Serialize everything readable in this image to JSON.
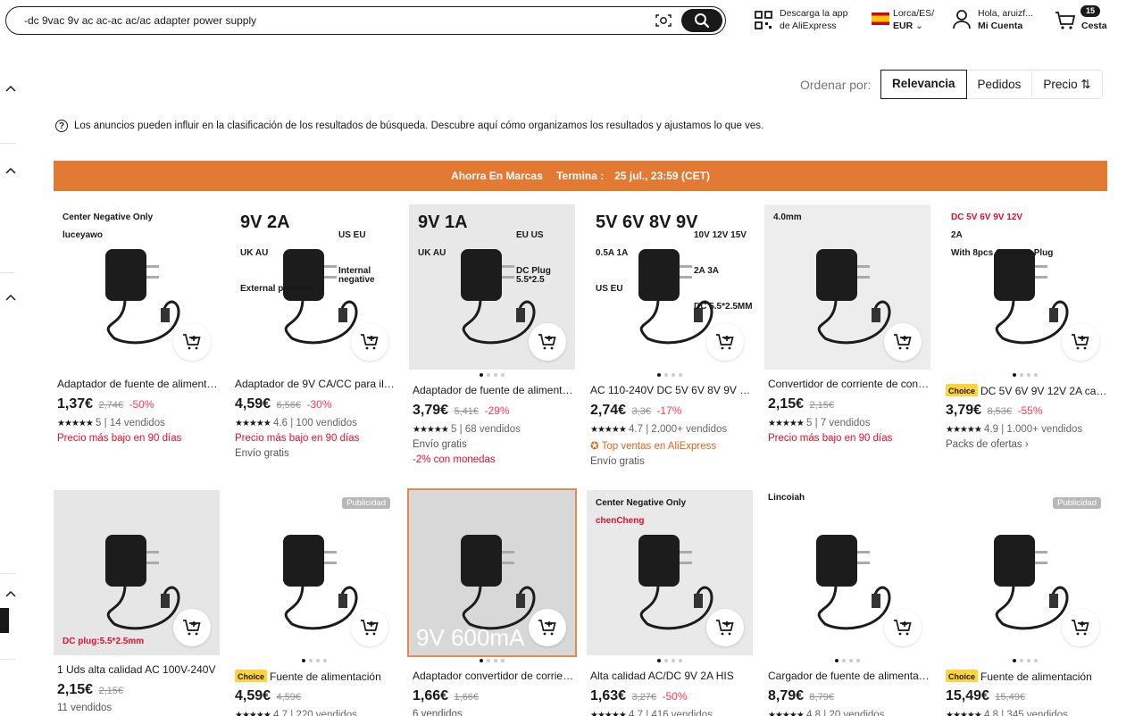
{
  "header": {
    "search_value": "-dc 9vac 9v ac ac-ac ac/ac adapter power supply",
    "app_line1": "Descarga la app",
    "app_line2": "de AliExpress",
    "region_line1": "Lorca/ES/",
    "region_line2": "EUR",
    "user_line1": "Hola, aruizf...",
    "user_line2": "Mi Cuenta",
    "cart_count": "15",
    "cart_label": "Cesta"
  },
  "sort": {
    "label": "Ordenar por:",
    "options": [
      "Relevancia",
      "Pedidos",
      "Precio"
    ],
    "active": "Relevancia"
  },
  "ads_notice": "Los anuncios pueden influir en la clasificación de los resultados de búsqueda. Descubre aquí cómo organizamos los resultados y ajustamos lo que ves.",
  "banner": {
    "title": "Ahorra En Marcas",
    "ends_label": "Termina :",
    "ends_value": "25 jul., 23:59 (CET)"
  },
  "products": [
    {
      "img_text": [
        "Center Negative Only",
        "luceyawo"
      ],
      "title": "Adaptador de fuente de alimentación",
      "choice": false,
      "price": "1,37€",
      "old": "2,74€",
      "disc": "-50%",
      "rating": "5",
      "sold": "14 vendidos",
      "lines": [
        {
          "t": "Precio más bajo en 90 días",
          "c": "red"
        }
      ]
    },
    {
      "img_text": [
        "9V 2A",
        "US EU",
        "UK AU",
        "Internal negative",
        "External positive"
      ],
      "title": "Adaptador de 9V CA/CC para iluminación",
      "choice": false,
      "price": "4,59€",
      "old": "6,56€",
      "disc": "-30%",
      "rating": "4.6",
      "sold": "100 vendidos",
      "lines": [
        {
          "t": "Precio más bajo en 90 días",
          "c": "red"
        },
        {
          "t": "Envío gratis",
          "c": "gray"
        }
      ]
    },
    {
      "img_text": [
        "9V 1A",
        "EU US",
        "UK AU",
        "DC Plug 5.5*2.5"
      ],
      "title": "Adaptador de fuente de alimentación",
      "choice": false,
      "price": "3,79€",
      "old": "5,41€",
      "disc": "-29%",
      "rating": "5",
      "sold": "68 vendidos",
      "lines": [
        {
          "t": "Envío gratis",
          "c": "gray"
        },
        {
          "t": "-2% con monedas",
          "c": "red"
        }
      ]
    },
    {
      "img_text": [
        "5V 6V 8V 9V",
        "10V 12V 15V",
        "0.5A 1A",
        "2A 3A",
        "US EU",
        "DC  5.5*2.5MM"
      ],
      "title": "AC 110-240V DC 5V 6V 8V 9V 10V",
      "choice": false,
      "price": "2,74€",
      "old": "3,3€",
      "disc": "-17%",
      "rating": "4.7",
      "sold": "2.000+ vendidos",
      "lines": [
        {
          "t": "Top ventas en AliExpress",
          "c": "orange"
        },
        {
          "t": "Envío gratis",
          "c": "gray"
        }
      ]
    },
    {
      "img_text": [
        "4.0mm"
      ],
      "title": "Convertidor de corriente de conmutación",
      "choice": false,
      "price": "2,15€",
      "old": "2,15€",
      "disc": "",
      "rating": "5",
      "sold": "7 vendidos",
      "lines": [
        {
          "t": "Precio más bajo en 90 días",
          "c": "red"
        }
      ]
    },
    {
      "img_text": [
        "DC 5V 6V 9V 12V",
        "2A",
        "With 8pcs Connect Plug"
      ],
      "title": "DC 5V 6V 9V 12V 2A cargador",
      "choice": true,
      "price": "3,79€",
      "old": "8,53€",
      "disc": "-55%",
      "rating": "4.9",
      "sold": "1.000+ vendidos",
      "lines": [
        {
          "t": "Packs de ofertas ›",
          "c": "gray"
        }
      ]
    },
    {
      "img_text": [
        "DC plug:5.5*2.5mm"
      ],
      "title": "1 Uds alta calidad AC 100V-240V",
      "choice": false,
      "price": "2,15€",
      "old": "2,15€",
      "disc": "",
      "rating": "",
      "sold": "",
      "lines": [
        {
          "t": "11 vendidos",
          "c": "gray"
        }
      ]
    },
    {
      "img_text": [
        "Publicidad"
      ],
      "title": "Fuente de alimentación",
      "choice": true,
      "price": "4,59€",
      "old": "4,59€",
      "disc": "",
      "rating": "4.7",
      "sold": "220 vendidos",
      "lines": []
    },
    {
      "img_text": [
        "9V 600mA"
      ],
      "title": "Adaptador convertidor de corriente",
      "choice": false,
      "price": "1,66€",
      "old": "1,66€",
      "disc": "",
      "rating": "",
      "sold": "",
      "lines": [
        {
          "t": "6 vendidos",
          "c": "gray"
        }
      ]
    },
    {
      "img_text": [
        "Center Negative Only",
        "chenCheng"
      ],
      "title": "Alta calidad AC/DC 9V 2A HIS",
      "choice": false,
      "price": "1,63€",
      "old": "3,27€",
      "disc": "-50%",
      "rating": "4.7",
      "sold": "416 vendidos",
      "lines": []
    },
    {
      "img_text": [
        "Lincoiah"
      ],
      "title": "Cargador de fuente de alimentación",
      "choice": false,
      "price": "8,79€",
      "old": "8,79€",
      "disc": "",
      "rating": "4.8",
      "sold": "20 vendidos",
      "lines": []
    },
    {
      "img_text": [
        "Publicidad"
      ],
      "title": "Fuente de alimentación",
      "choice": true,
      "price": "15,49€",
      "old": "15,49€",
      "disc": "",
      "rating": "4.8",
      "sold": "345 vendidos",
      "lines": []
    }
  ]
}
